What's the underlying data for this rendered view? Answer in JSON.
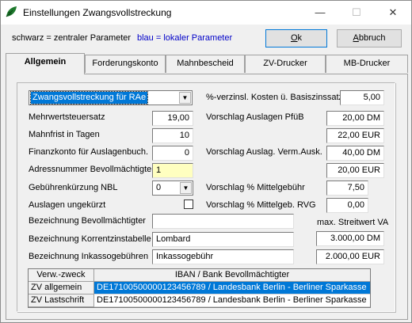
{
  "window": {
    "title": "Einstellungen Zwangsvollstreckung",
    "minimize": "—",
    "maximize": "☐",
    "close": "✕"
  },
  "legend": {
    "black": "schwarz = zentraler Parameter",
    "blue": "blau = lokaler Parameter",
    "blue_color": "#0000c8"
  },
  "buttons": {
    "ok_mnemonic": "O",
    "ok_rest": "k",
    "cancel_mnemonic": "A",
    "cancel_rest": "bbruch"
  },
  "tabs": [
    "Allgemein",
    "Forderungskonto",
    "Mahnbescheid",
    "ZV-Drucker",
    "MB-Drucker"
  ],
  "form": {
    "zv_type": "Zwangsvollstreckung für RAe",
    "mwst_label": "Mehrwertsteuersatz",
    "mwst_value": "19,00",
    "mahnfrist_label": "Mahnfrist in Tagen",
    "mahnfrist_value": "10",
    "finanzkonto_label": "Finanzkonto für Auslagenbuch.",
    "finanzkonto_value": "0",
    "adressnummer_label": "Adressnummer Bevollmächtigter",
    "adressnummer_value": "1",
    "gebuehren_label": "Gebührenkürzung NBL",
    "gebuehren_value": "0",
    "auslagen_label": "Auslagen ungekürzt",
    "verzinsl_label": "%-verzinsl. Kosten ü. Basiszinssatz",
    "verzinsl_value": "5,00",
    "pfueb_label": "Vorschlag Auslagen PfüB",
    "pfueb_value1": "20,00 DM",
    "pfueb_value2": "22,00 EUR",
    "vermausk_label": "Vorschlag Auslag. Verm.Ausk.",
    "vermausk_value1": "40,00 DM",
    "vermausk_value2": "20,00 EUR",
    "mittelgeb_label": "Vorschlag % Mittelgebühr",
    "mittelgeb_value": "7,50",
    "mittelgeb_rvg_label": "Vorschlag % Mittelgeb. RVG",
    "mittelgeb_rvg_value": "0,00",
    "bez_bevoll_label": "Bezeichnung Bevollmächtigter",
    "bez_bevoll_value": "",
    "max_streitwert_label": "max. Streitwert VA",
    "bez_korrenz_label": "Bezeichnung Korrentzinstabelle",
    "bez_korrenz_value": "Lombard",
    "max_streitwert_value": "3.000,00 DM",
    "bez_inkasso_label": "Bezeichnung Inkassogebühren",
    "bez_inkasso_value": "Inkassogebühr",
    "inkasso_eur_value": "2.000,00 EUR"
  },
  "grid": {
    "col1": "Verw.-zweck",
    "col2": "IBAN / Bank Bevollmächtigter",
    "rows": [
      {
        "zweck": "ZV allgemein",
        "iban": "DE17100500000123456789 / Landesbank Berlin - Berliner Sparkasse"
      },
      {
        "zweck": "ZV Lastschrift",
        "iban": "DE17100500000123456789 / Landesbank Berlin - Berliner Sparkasse"
      }
    ]
  }
}
